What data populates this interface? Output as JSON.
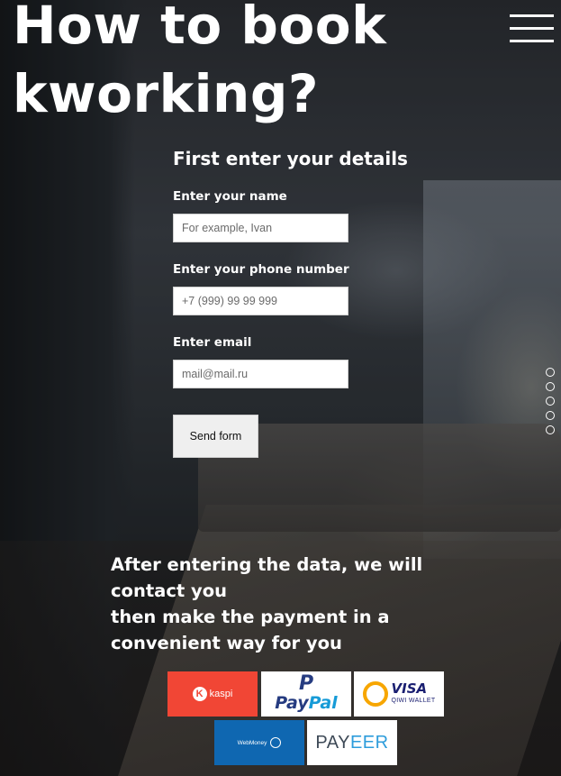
{
  "page": {
    "title": "How to book kworking?"
  },
  "form": {
    "heading": "First enter your details",
    "name_label": "Enter your name",
    "name_placeholder": "For example, Ivan",
    "phone_label": "Enter your phone number",
    "phone_placeholder": "+7 (999) 99 99 999",
    "email_label": "Enter email",
    "email_placeholder": "mail@mail.ru",
    "submit_label": "Send form"
  },
  "info": {
    "line1": "After entering the data, we will contact you",
    "line2": "then make the payment in a convenient way for you"
  },
  "payment_methods": {
    "kaspi": "kaspi",
    "paypal_a": "Pay",
    "paypal_b": "Pal",
    "qiwi_visa": "VISA",
    "qiwi_sub": "QIWI WALLET",
    "webmoney": "WebMoney",
    "payeer_a": "PAY",
    "payeer_b": "EER"
  },
  "slider": {
    "dot_count": 5
  },
  "colors": {
    "kaspi": "#f14635",
    "paypal_dark": "#253b80",
    "paypal_light": "#179bd7",
    "webmoney": "#0f67b1",
    "qiwi_orange": "#f7a600"
  },
  "icons": {
    "menu": "hamburger-menu-icon"
  }
}
